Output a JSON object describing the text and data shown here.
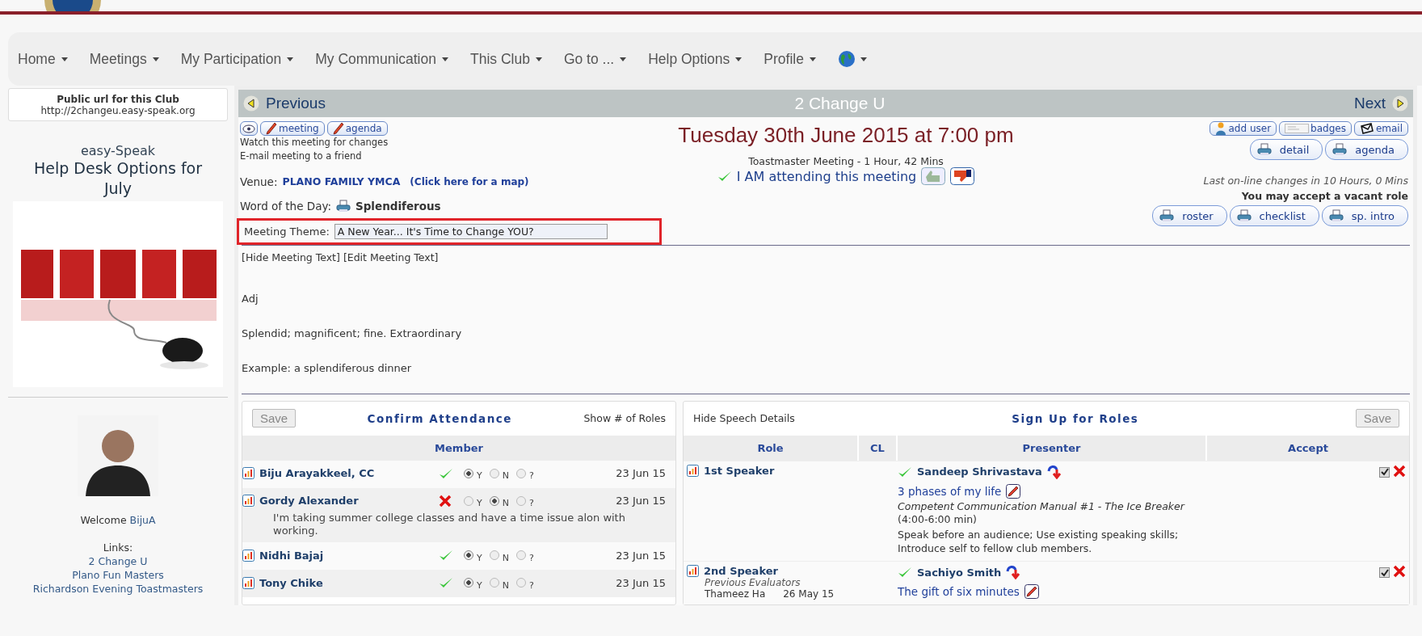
{
  "nav": {
    "items": [
      {
        "label": "Home"
      },
      {
        "label": "Meetings"
      },
      {
        "label": "My Participation"
      },
      {
        "label": "My Communication"
      },
      {
        "label": "This Club"
      },
      {
        "label": "Go to ..."
      },
      {
        "label": "Help Options"
      },
      {
        "label": "Profile"
      }
    ]
  },
  "sidebar": {
    "public_url": {
      "title": "Public url for this Club",
      "url": "http://2changeu.easy-speak.org"
    },
    "help_desk": {
      "brand": "easy-Speak",
      "title": "Help Desk Options for July"
    },
    "profile": {
      "welcome": "Welcome",
      "username": "BijuA",
      "links_label": "Links:",
      "links": [
        "2 Change U",
        "Plano Fun Masters",
        "Richardson Evening Toastmasters"
      ]
    }
  },
  "meeting": {
    "previous": "Previous",
    "club": "2 Change U",
    "next": "Next",
    "edit_buttons": [
      "meeting",
      "agenda"
    ],
    "watch": "Watch this meeting for changes",
    "email_friend": "E-mail meeting to a friend",
    "title": "Tuesday 30th June 2015 at 7:00 pm",
    "subtitle": "Toastmaster Meeting - 1 Hour, 42 Mins",
    "attending": "I AM attending this meeting",
    "venue_label": "Venue:",
    "venue": "PLANO FAMILY YMCA",
    "map_link": "(Click here for a map)",
    "word_label": "Word of the Day:",
    "word": "Splendiferous",
    "theme_label": "Meeting Theme:",
    "theme": "A New Year... It's Time to Change YOU?",
    "theme_highlighted": true,
    "text_links": [
      "[Hide Meeting Text]",
      "[Edit Meeting Text]"
    ],
    "text_lines": [
      "Adj",
      "Splendid; magnificent; fine. Extraordinary",
      "Example: a splendiferous dinner"
    ],
    "tool_buttons": [
      "add user",
      "badges",
      "email"
    ],
    "print_buttons": [
      "detail",
      "agenda"
    ],
    "last_changes": "Last on-line changes in 10 Hours, 0 Mins",
    "vacant_note": "You may accept a vacant role",
    "print_buttons_2": [
      "roster",
      "checklist",
      "sp. intro"
    ]
  },
  "attendance": {
    "save": "Save",
    "title": "Confirm Attendance",
    "show_roles": "Show # of Roles",
    "column": "Member",
    "rows": [
      {
        "name": "Biju Arayakkeel, CC",
        "date": "23 Jun 15",
        "options": [
          {
            "label": "Y",
            "selected": true
          },
          {
            "label": "N",
            "selected": false
          },
          {
            "label": "?",
            "selected": false
          }
        ]
      },
      {
        "name": "Gordy Alexander",
        "date": "23 Jun 15",
        "options": [
          {
            "label": "Y",
            "selected": false
          },
          {
            "label": "N",
            "selected": true
          },
          {
            "label": "?",
            "selected": false
          }
        ],
        "note": "I'm taking summer college classes and have a time issue alon with working."
      },
      {
        "name": "Nidhi Bajaj",
        "date": "23 Jun 15",
        "options": [
          {
            "label": "Y",
            "selected": true
          },
          {
            "label": "N",
            "selected": false
          },
          {
            "label": "?",
            "selected": false
          }
        ]
      },
      {
        "name": "Tony Chike",
        "date": "23 Jun 15",
        "options": [
          {
            "label": "Y",
            "selected": true
          },
          {
            "label": "N",
            "selected": false
          },
          {
            "label": "?",
            "selected": false
          }
        ]
      }
    ]
  },
  "roles": {
    "hide_details": "Hide Speech Details",
    "title": "Sign Up for Roles",
    "save": "Save",
    "columns": [
      "Role",
      "CL",
      "Presenter",
      "Accept"
    ],
    "rows": [
      {
        "role": "1st Speaker",
        "presenter": "Sandeep Shrivastava",
        "speech_title": "3 phases of my life",
        "manual": "*Competent Communication Manual #1 - The Ice Breaker* (4:00-6:00 min)",
        "objectives": "Speak before an audience; Use existing speaking skills; Introduce self to fellow club members.",
        "accepted": true
      },
      {
        "role": "2nd Speaker",
        "evaluators_label": "Previous Evaluators",
        "evaluators": [
          {
            "name": "Thameez Ha",
            "date": "26 May 15"
          }
        ],
        "presenter": "Sachiyo Smith",
        "speech_title": "The gift of six minutes",
        "accepted": true
      }
    ]
  }
}
